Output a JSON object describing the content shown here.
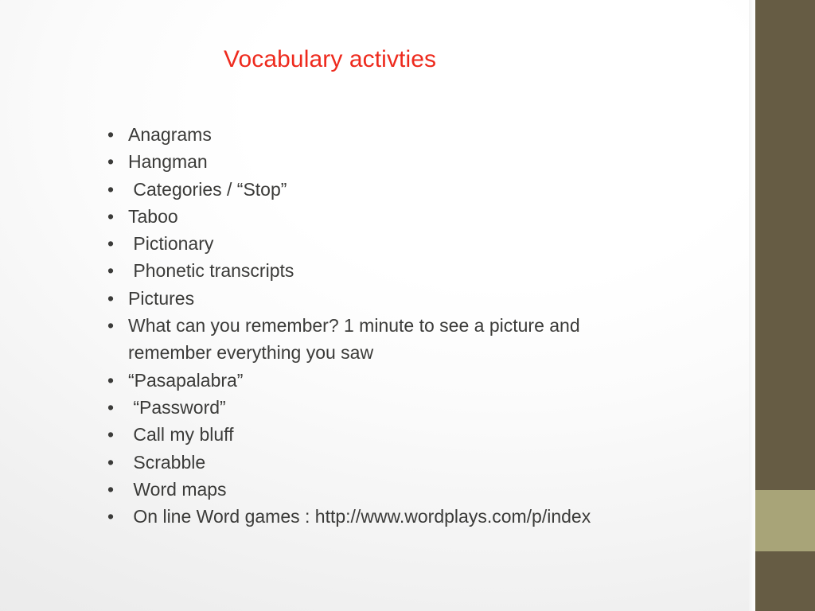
{
  "slide": {
    "title": "Vocabulary activties",
    "title_color": "#ee2a1d",
    "text_color": "#3b3b39",
    "background_color": "#ffffff",
    "accent_bar_color": "#665c44",
    "accent_band_color": "#a8a478",
    "bullet_glyph": "•",
    "bullets": [
      {
        "text": "Anagrams"
      },
      {
        "text": "Hangman"
      },
      {
        "text": " Categories / “Stop”"
      },
      {
        "text": "Taboo"
      },
      {
        "text": " Pictionary"
      },
      {
        "text": " Phonetic transcripts"
      },
      {
        "text": "Pictures"
      },
      {
        "text": "What can you remember? 1 minute to see a picture and remember everything you saw"
      },
      {
        "text": "“Pasapalabra”"
      },
      {
        "text": " “Password”"
      },
      {
        "text": " Call my bluff"
      },
      {
        "text": " Scrabble"
      },
      {
        "text": " Word maps"
      },
      {
        "text": " On line Word games : http://www.wordplays.com/p/index"
      }
    ]
  }
}
